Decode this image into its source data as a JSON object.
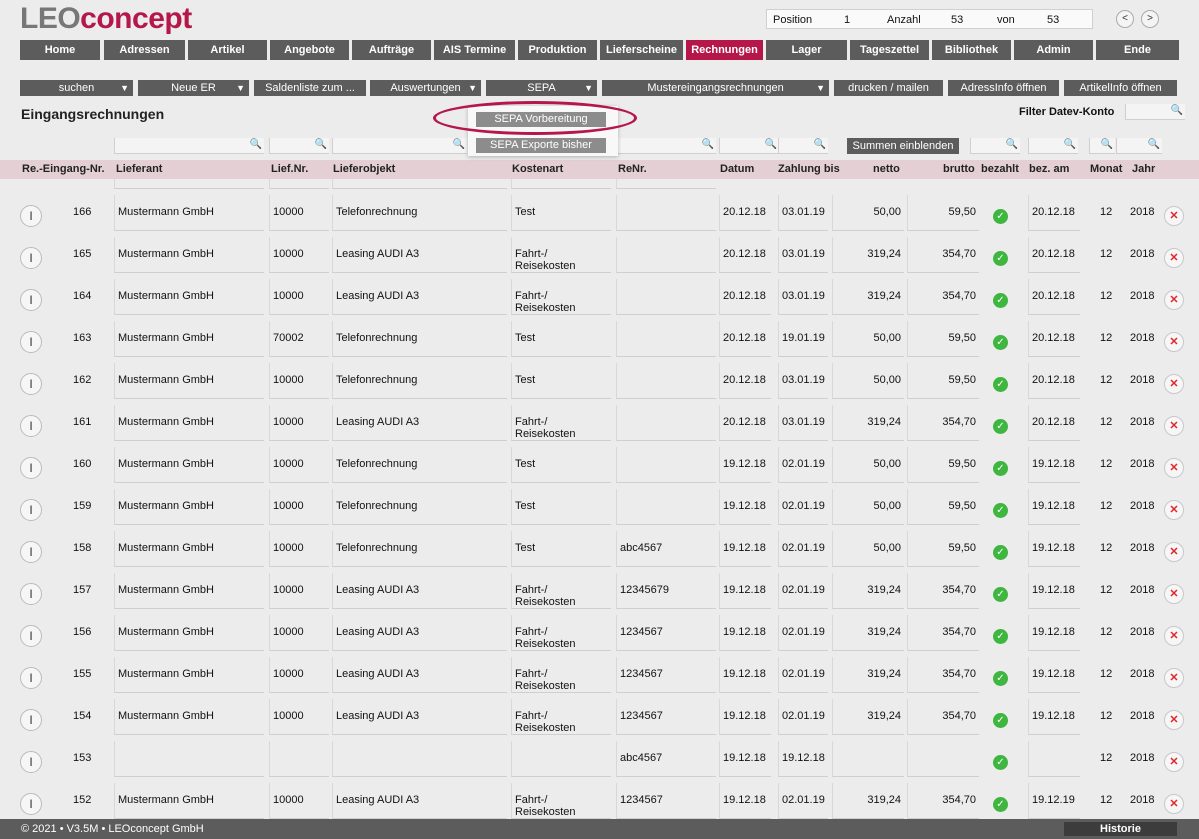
{
  "logo": {
    "part1": "LEO",
    "part2": "concept"
  },
  "position": {
    "position_label": "Position",
    "position_value": "1",
    "count_label": "Anzahl",
    "count_value": "53",
    "of_label": "von",
    "of_value": "53",
    "prev": "<",
    "next": ">"
  },
  "nav": [
    "Home",
    "Adressen",
    "Artikel",
    "Angebote",
    "Aufträge",
    "AIS Termine",
    "Produktion",
    "Lieferscheine",
    "Rechnungen",
    "Lager",
    "Tageszettel",
    "Bibliothek",
    "Admin",
    "Ende"
  ],
  "nav_active": "Rechnungen",
  "toolbar": [
    {
      "label": "suchen",
      "caret": true
    },
    {
      "label": "Neue ER",
      "caret": true
    },
    {
      "label": "Saldenliste zum ...",
      "caret": false
    },
    {
      "label": "Auswertungen",
      "caret": true
    },
    {
      "label": "SEPA",
      "caret": true
    },
    {
      "label": "Mustereingangsrechnungen",
      "caret": true
    },
    {
      "label": "drucken / mailen",
      "caret": false
    },
    {
      "label": "AdressInfo öffnen",
      "caret": false
    },
    {
      "label": "ArtikelInfo öffnen",
      "caret": false
    }
  ],
  "page_title": "Eingangsrechnungen",
  "filter_label": "Filter Datev-Konto",
  "sepa_menu": {
    "item1": "SEPA Vorbereitung",
    "item2": "SEPA Exporte bisher"
  },
  "summen_label": "Summen einblenden",
  "columns": {
    "nr": "Re.-Eingang-Nr.",
    "lieferant": "Lieferant",
    "liefnr": "Lief.Nr.",
    "lieferobjekt": "Lieferobjekt",
    "kostenart": "Kostenart",
    "renr": "ReNr.",
    "datum": "Datum",
    "zahlung": "Zahlung bis",
    "netto": "netto",
    "brutto": "brutto",
    "bezahlt": "bezahlt",
    "bezam": "bez. am",
    "monat": "Monat",
    "jahr": "Jahr"
  },
  "partial_row_kostenart": "Reisekosten",
  "rows": [
    {
      "nr": "166",
      "lieferant": "Mustermann GmbH",
      "liefnr": "10000",
      "lieferobjekt": "Telefonrechnung",
      "kostenart": "Test",
      "renr": "",
      "datum": "20.12.18",
      "zahlung": "03.01.19",
      "netto": "50,00",
      "brutto": "59,50",
      "bezam": "20.12.18",
      "monat": "12",
      "jahr": "2018"
    },
    {
      "nr": "165",
      "lieferant": "Mustermann GmbH",
      "liefnr": "10000",
      "lieferobjekt": "Leasing AUDI A3",
      "kostenart": "Fahrt-/\nReisekosten",
      "renr": "",
      "datum": "20.12.18",
      "zahlung": "03.01.19",
      "netto": "319,24",
      "brutto": "354,70",
      "bezam": "20.12.18",
      "monat": "12",
      "jahr": "2018"
    },
    {
      "nr": "164",
      "lieferant": "Mustermann GmbH",
      "liefnr": "10000",
      "lieferobjekt": "Leasing AUDI A3",
      "kostenart": "Fahrt-/\nReisekosten",
      "renr": "",
      "datum": "20.12.18",
      "zahlung": "03.01.19",
      "netto": "319,24",
      "brutto": "354,70",
      "bezam": "20.12.18",
      "monat": "12",
      "jahr": "2018"
    },
    {
      "nr": "163",
      "lieferant": "Mustermann GmbH",
      "liefnr": "70002",
      "lieferobjekt": "Telefonrechnung",
      "kostenart": "Test",
      "renr": "",
      "datum": "20.12.18",
      "zahlung": "19.01.19",
      "netto": "50,00",
      "brutto": "59,50",
      "bezam": "20.12.18",
      "monat": "12",
      "jahr": "2018"
    },
    {
      "nr": "162",
      "lieferant": "Mustermann GmbH",
      "liefnr": "10000",
      "lieferobjekt": "Telefonrechnung",
      "kostenart": "Test",
      "renr": "",
      "datum": "20.12.18",
      "zahlung": "03.01.19",
      "netto": "50,00",
      "brutto": "59,50",
      "bezam": "20.12.18",
      "monat": "12",
      "jahr": "2018"
    },
    {
      "nr": "161",
      "lieferant": "Mustermann GmbH",
      "liefnr": "10000",
      "lieferobjekt": "Leasing AUDI A3",
      "kostenart": "Fahrt-/\nReisekosten",
      "renr": "",
      "datum": "20.12.18",
      "zahlung": "03.01.19",
      "netto": "319,24",
      "brutto": "354,70",
      "bezam": "20.12.18",
      "monat": "12",
      "jahr": "2018"
    },
    {
      "nr": "160",
      "lieferant": "Mustermann GmbH",
      "liefnr": "10000",
      "lieferobjekt": "Telefonrechnung",
      "kostenart": "Test",
      "renr": "",
      "datum": "19.12.18",
      "zahlung": "02.01.19",
      "netto": "50,00",
      "brutto": "59,50",
      "bezam": "19.12.18",
      "monat": "12",
      "jahr": "2018"
    },
    {
      "nr": "159",
      "lieferant": "Mustermann GmbH",
      "liefnr": "10000",
      "lieferobjekt": "Telefonrechnung",
      "kostenart": "Test",
      "renr": "",
      "datum": "19.12.18",
      "zahlung": "02.01.19",
      "netto": "50,00",
      "brutto": "59,50",
      "bezam": "19.12.18",
      "monat": "12",
      "jahr": "2018"
    },
    {
      "nr": "158",
      "lieferant": "Mustermann GmbH",
      "liefnr": "10000",
      "lieferobjekt": "Telefonrechnung",
      "kostenart": "Test",
      "renr": "abc4567",
      "datum": "19.12.18",
      "zahlung": "02.01.19",
      "netto": "50,00",
      "brutto": "59,50",
      "bezam": "19.12.18",
      "monat": "12",
      "jahr": "2018"
    },
    {
      "nr": "157",
      "lieferant": "Mustermann GmbH",
      "liefnr": "10000",
      "lieferobjekt": "Leasing AUDI A3",
      "kostenart": "Fahrt-/\nReisekosten",
      "renr": "12345679",
      "datum": "19.12.18",
      "zahlung": "02.01.19",
      "netto": "319,24",
      "brutto": "354,70",
      "bezam": "19.12.18",
      "monat": "12",
      "jahr": "2018"
    },
    {
      "nr": "156",
      "lieferant": "Mustermann GmbH",
      "liefnr": "10000",
      "lieferobjekt": "Leasing AUDI A3",
      "kostenart": "Fahrt-/\nReisekosten",
      "renr": "1234567",
      "datum": "19.12.18",
      "zahlung": "02.01.19",
      "netto": "319,24",
      "brutto": "354,70",
      "bezam": "19.12.18",
      "monat": "12",
      "jahr": "2018"
    },
    {
      "nr": "155",
      "lieferant": "Mustermann GmbH",
      "liefnr": "10000",
      "lieferobjekt": "Leasing AUDI A3",
      "kostenart": "Fahrt-/\nReisekosten",
      "renr": "1234567",
      "datum": "19.12.18",
      "zahlung": "02.01.19",
      "netto": "319,24",
      "brutto": "354,70",
      "bezam": "19.12.18",
      "monat": "12",
      "jahr": "2018"
    },
    {
      "nr": "154",
      "lieferant": "Mustermann GmbH",
      "liefnr": "10000",
      "lieferobjekt": "Leasing AUDI A3",
      "kostenart": "Fahrt-/\nReisekosten",
      "renr": "1234567",
      "datum": "19.12.18",
      "zahlung": "02.01.19",
      "netto": "319,24",
      "brutto": "354,70",
      "bezam": "19.12.18",
      "monat": "12",
      "jahr": "2018"
    },
    {
      "nr": "153",
      "lieferant": "",
      "liefnr": "",
      "lieferobjekt": "",
      "kostenart": "",
      "renr": "abc4567",
      "datum": "19.12.18",
      "zahlung": "19.12.18",
      "netto": "",
      "brutto": "",
      "bezam": "",
      "monat": "12",
      "jahr": "2018"
    },
    {
      "nr": "152",
      "lieferant": "Mustermann GmbH",
      "liefnr": "10000",
      "lieferobjekt": "Leasing AUDI A3",
      "kostenart": "Fahrt-/\nReisekosten",
      "renr": "1234567",
      "datum": "19.12.18",
      "zahlung": "02.01.19",
      "netto": "319,24",
      "brutto": "354,70",
      "bezam": "19.12.19",
      "monat": "12",
      "jahr": "2018"
    }
  ],
  "footer": {
    "copyright": "© 2021 • V3.5M • LEOconcept GmbH",
    "historie": "Historie"
  },
  "icons": {
    "info": "info-icon",
    "paid": "check-circle-icon",
    "delete": "delete-x-icon",
    "search": "search-icon"
  },
  "colors": {
    "accent": "#b5174b",
    "button": "#5c5c5c",
    "header_row": "#e3cfd4",
    "paid": "#3fb63f",
    "delete": "#e0262b"
  }
}
